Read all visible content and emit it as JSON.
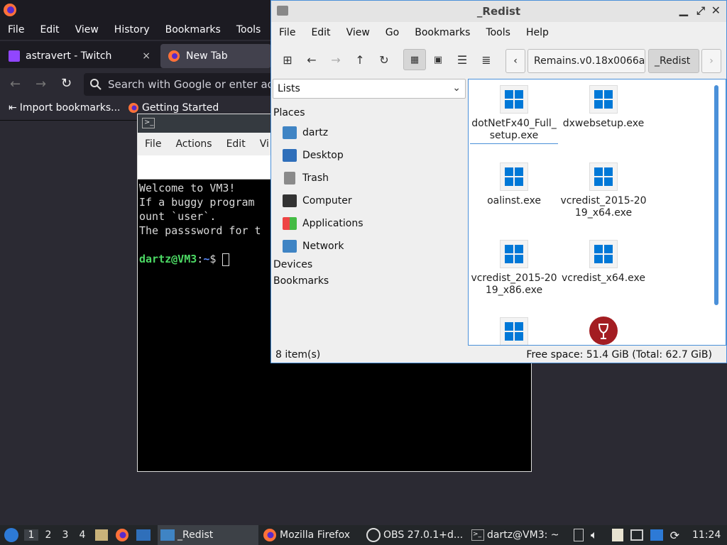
{
  "firefox": {
    "menu": [
      "File",
      "Edit",
      "View",
      "History",
      "Bookmarks",
      "Tools",
      "H"
    ],
    "tabs": [
      {
        "label": "astravert - Twitch",
        "close": "×"
      },
      {
        "label": "New Tab"
      }
    ],
    "url_placeholder": "Search with Google or enter add",
    "bookmarks": [
      "Import bookmarks...",
      "Getting Started"
    ]
  },
  "terminal": {
    "menu": [
      "File",
      "Actions",
      "Edit",
      "Vi"
    ],
    "lines": [
      "Welcome to VM3!",
      "If a buggy program",
      "ount `user`.",
      "The passsword for t"
    ],
    "prompt_user": "dartz@VM3",
    "prompt_sep": ":",
    "prompt_path": "~",
    "prompt_end": "$ "
  },
  "file_manager": {
    "title": "_Redist",
    "menu": [
      "File",
      "Edit",
      "View",
      "Go",
      "Bookmarks",
      "Tools",
      "Help"
    ],
    "breadcrumbs": [
      "Remains.v0.18x0066a",
      "_Redist"
    ],
    "view_mode": "Lists",
    "places_header": "Places",
    "places": [
      "dartz",
      "Desktop",
      "Trash",
      "Computer",
      "Applications",
      "Network"
    ],
    "devices_header": "Devices",
    "bookmarks_header": "Bookmarks",
    "files": [
      {
        "name": "dotNetFx40_Full_setup.exe",
        "icon": "windows-icon"
      },
      {
        "name": "dxwebsetup.exe",
        "icon": "windows-icon"
      },
      {
        "name": "oalinst.exe",
        "icon": "windows-icon"
      },
      {
        "name": "vcredist_2015-2019_x64.exe",
        "icon": "windows-icon"
      },
      {
        "name": "vcredist_2015-2019_x86.exe",
        "icon": "windows-icon"
      },
      {
        "name": "vcredist_x64.exe",
        "icon": "windows-icon"
      },
      {
        "name": "",
        "icon": "windows-icon"
      },
      {
        "name": "",
        "icon": "wine-icon"
      }
    ],
    "status_count": "8 item(s)",
    "status_space": "Free space: 51.4 GiB (Total: 62.7 GiB)"
  },
  "taskbar": {
    "workspaces": [
      "1",
      "2",
      "3",
      "4"
    ],
    "tasks": [
      "_Redist",
      "Mozilla Firefox",
      "OBS 27.0.1+d...",
      "dartz@VM3: ~"
    ],
    "clock": "11:24"
  },
  "colors": {
    "accent": "#4a90d9",
    "windows_blue": "#0078d7",
    "wine_red": "#a31d22"
  }
}
